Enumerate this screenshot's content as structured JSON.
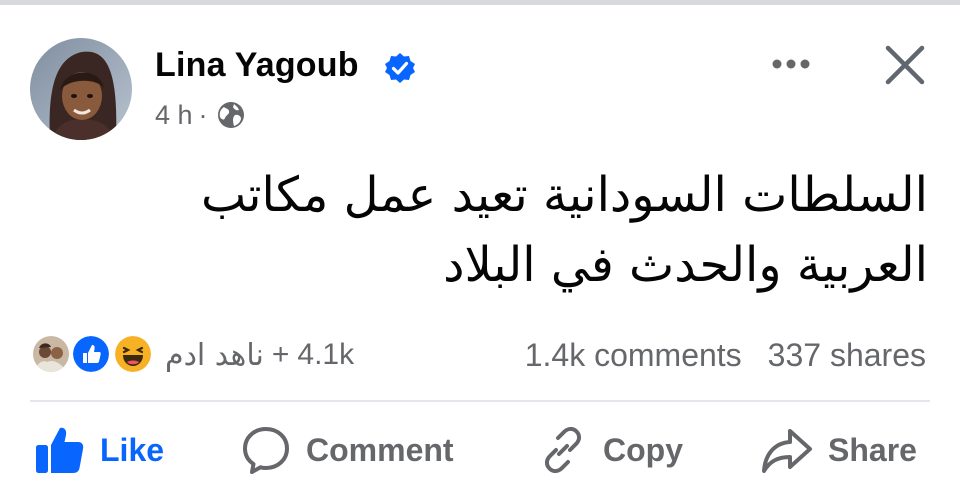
{
  "post": {
    "author": "Lina Yagoub",
    "verified_icon": "verified-badge-icon",
    "time": "4 h",
    "separator": "·",
    "audience_icon": "globe-icon",
    "text_line1": "السلطات السودانية تعيد عمل مكاتب",
    "text_line2": "العربية والحدث في البلاد"
  },
  "reactions": {
    "icons": [
      "reactor-photo",
      "like-icon",
      "haha-icon"
    ],
    "reactor_name": "ناهد ادم",
    "plus": "+",
    "count": "4.1k"
  },
  "counts": {
    "comments": "1.4k comments",
    "shares": "337 shares"
  },
  "actions": {
    "like": "Like",
    "comment": "Comment",
    "copy": "Copy",
    "share": "Share"
  },
  "colors": {
    "accent": "#0866ff",
    "secondary_text": "#65676b",
    "primary_text": "#050505",
    "haha": "#f7b125",
    "divider": "#e4e6eb"
  }
}
